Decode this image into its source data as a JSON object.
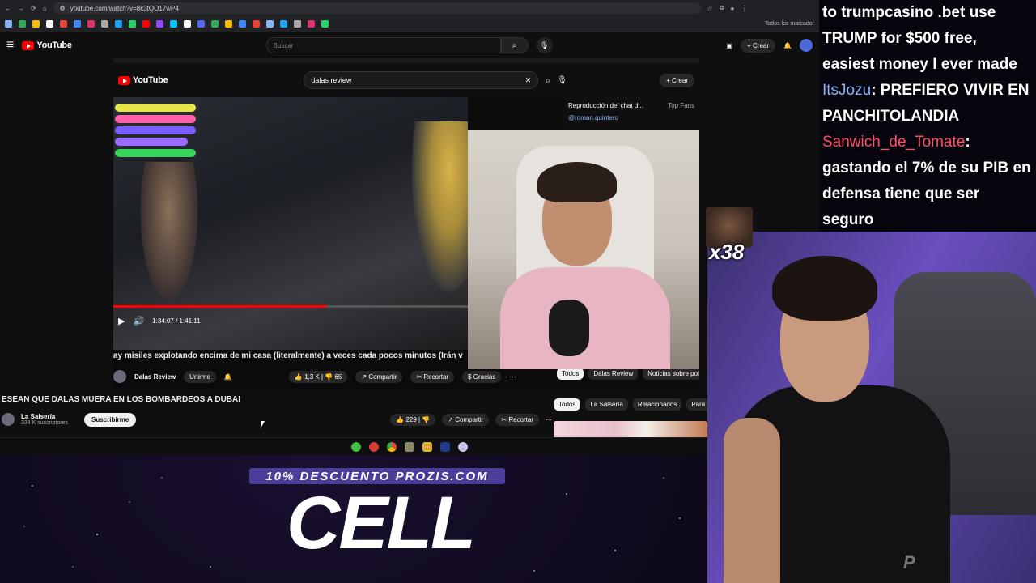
{
  "browser": {
    "url": "youtube.com/watch?v=8k3tQO17wP4",
    "all_bookmarks": "Todos los marcador"
  },
  "youtube": {
    "logo": "YouTube",
    "search_placeholder": "Buscar",
    "create_label": "Crear",
    "video_title": "ESEAN QUE DALAS MUERA EN LOS BOMBARDEOS A DUBAI",
    "channel": "La Salsería",
    "subscribers": "334 K suscriptores",
    "subscribe_label": "Suscribirme",
    "likes": "229",
    "share_label": "Compartir",
    "clip_label": "Recortar",
    "chips": [
      "Todos",
      "La Salsería",
      "Relacionados",
      "Para ti"
    ]
  },
  "inner_video": {
    "search_value": "dalas review",
    "create_label": "Crear",
    "chat_header": "Reproducción del chat d...",
    "top_fans": "Top Fans",
    "chat_user": "@roman.quintero",
    "time": "1:34:07 / 1:41:11",
    "title": "ay misiles explotando encima de mi casa (literalmente) a veces cada pocos minutos (Irán v",
    "channel": "Dalas Review",
    "join_label": "Unirme",
    "likes": "1,3 K",
    "dislikes": "65",
    "share_label": "Compartir",
    "clip_label": "Recortar",
    "thanks_label": "Gracias",
    "chips": [
      "Todos",
      "Dalas Review",
      "Noticias sobre políti"
    ]
  },
  "stream_chat": {
    "line1": "to trumpcasino .bet use TRUMP for $500 free, easiest money I ever made",
    "user2": "ItsJozu",
    "msg2": ": PREFIERO VIVIR EN PANCHITOLANDIA",
    "user3": "Sanwich_de_Tomate",
    "msg3": ": gastando el 7% de su PIB en defensa tiene que ser seguro",
    "user2_color": "#8ab4ff",
    "user3_color": "#ff4d6d"
  },
  "emote": {
    "count": "x38"
  },
  "sponsor": {
    "banner": "10% DESCUENTO PROZIS.COM",
    "code": "CELL"
  }
}
